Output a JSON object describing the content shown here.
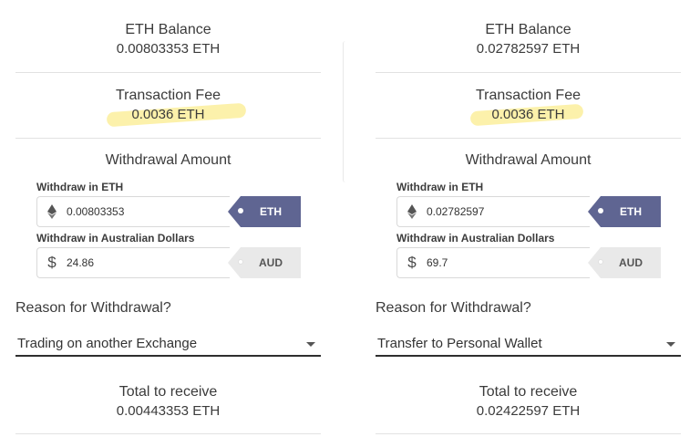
{
  "panels": [
    {
      "balance_label": "ETH Balance",
      "balance_value": "0.00803353 ETH",
      "fee_label": "Transaction Fee",
      "fee_value": "0.0036 ETH",
      "withdrawal_amount_label": "Withdrawal Amount",
      "eth_field_title": "Withdraw in ETH",
      "eth_value": "0.00803353",
      "eth_tag": "ETH",
      "aud_field_title": "Withdraw in Australian Dollars",
      "aud_value": "24.86",
      "aud_tag": "AUD",
      "reason_label": "Reason for Withdrawal?",
      "reason_selected": "Trading on another Exchange",
      "total_label": "Total to receive",
      "total_value": "0.00443353 ETH"
    },
    {
      "balance_label": "ETH Balance",
      "balance_value": "0.02782597 ETH",
      "fee_label": "Transaction Fee",
      "fee_value": "0.0036 ETH",
      "withdrawal_amount_label": "Withdrawal Amount",
      "eth_field_title": "Withdraw in ETH",
      "eth_value": "0.02782597",
      "eth_tag": "ETH",
      "aud_field_title": "Withdraw in Australian Dollars",
      "aud_value": "69.7",
      "aud_tag": "AUD",
      "reason_label": "Reason for Withdrawal?",
      "reason_selected": "Transfer to Personal Wallet",
      "total_label": "Total to receive",
      "total_value": "0.02422597 ETH"
    }
  ],
  "icons": {
    "eth": "ethereum-icon",
    "aud": "dollar-icon",
    "dropdown": "chevron-down-icon"
  },
  "colors": {
    "active_tag": "#5f6592",
    "inactive_tag": "#e9e9e9",
    "highlight": "#fae878"
  }
}
